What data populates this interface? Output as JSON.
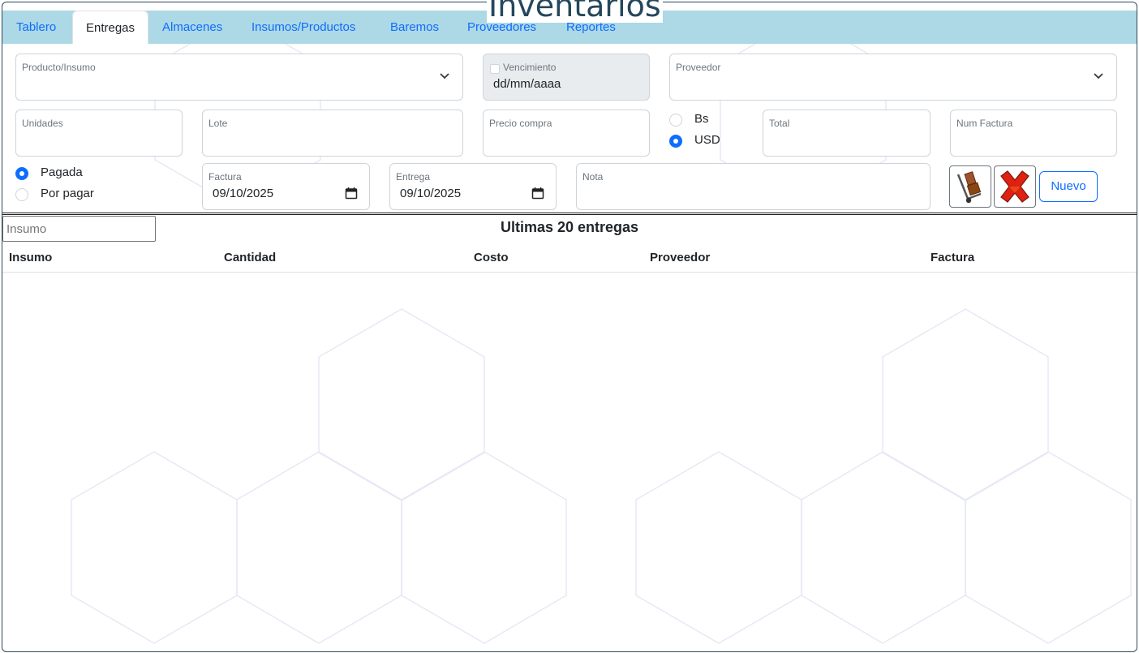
{
  "app": {
    "title": "Inventarios"
  },
  "tabs": [
    {
      "label": "Tablero",
      "active": false
    },
    {
      "label": "Entregas",
      "active": true
    },
    {
      "label": "Almacenes",
      "active": false
    },
    {
      "label": "Insumos/Productos",
      "active": false
    },
    {
      "label": "Baremos",
      "active": false
    },
    {
      "label": "Proveedores",
      "active": false
    },
    {
      "label": "Reportes",
      "active": false
    }
  ],
  "form": {
    "producto": {
      "label": "Producto/Insumo",
      "value": ""
    },
    "vencimiento": {
      "label": "Vencimiento",
      "value": "dd/mm/aaaa",
      "checked": false,
      "disabled": true
    },
    "proveedor": {
      "label": "Proveedor",
      "value": ""
    },
    "unidades": {
      "label": "Unidades",
      "value": ""
    },
    "lote": {
      "label": "Lote",
      "value": ""
    },
    "precio_compra": {
      "label": "Precio compra",
      "value": ""
    },
    "moneda": {
      "options": [
        "Bs",
        "USD"
      ],
      "selected": "USD"
    },
    "total": {
      "label": "Total",
      "value": ""
    },
    "num_factura": {
      "label": "Num Factura",
      "value": ""
    },
    "estado_pago": {
      "options": [
        "Pagada",
        "Por pagar"
      ],
      "selected": "Pagada"
    },
    "fecha_factura": {
      "label": "Factura",
      "value": "09/10/2025"
    },
    "fecha_entrega": {
      "label": "Entrega",
      "value": "09/10/2025"
    },
    "nota": {
      "label": "Nota",
      "value": ""
    }
  },
  "actions": {
    "deliver_icon": "hand-truck-icon",
    "cancel_icon": "red-x-icon",
    "nuevo_label": "Nuevo"
  },
  "list": {
    "search_placeholder": "Insumo",
    "title": "Ultimas 20 entregas",
    "columns": [
      "Insumo",
      "Cantidad",
      "Costo",
      "Proveedor",
      "Factura"
    ],
    "rows": []
  },
  "colors": {
    "navbar": "#add8e6",
    "accent": "#0d6efd",
    "title": "#24475c"
  }
}
